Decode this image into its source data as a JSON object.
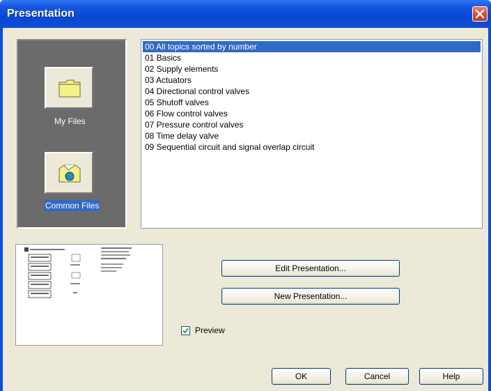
{
  "window": {
    "title": "Presentation"
  },
  "sources": [
    {
      "label": "My Files",
      "icon": "folder-icon",
      "selected": false
    },
    {
      "label": "Common Files",
      "icon": "globe-folder-icon",
      "selected": true
    }
  ],
  "topics": [
    "00 All topics sorted by number",
    "01 Basics",
    "02 Supply elements",
    "03 Actuators",
    "04 Directional control valves",
    "05 Shutoff valves",
    "06 Flow control valves",
    "07 Pressure control valves",
    "08 Time delay valve",
    "09 Sequential circuit and signal overlap circuit"
  ],
  "selected_topic_index": 0,
  "buttons": {
    "edit": "Edit Presentation...",
    "new": "New Presentation...",
    "ok": "OK",
    "cancel": "Cancel",
    "help": "Help"
  },
  "preview_checkbox": {
    "label": "Preview",
    "checked": true
  },
  "colors": {
    "selection": "#316ac5",
    "titlebar": "#0a48d4"
  }
}
